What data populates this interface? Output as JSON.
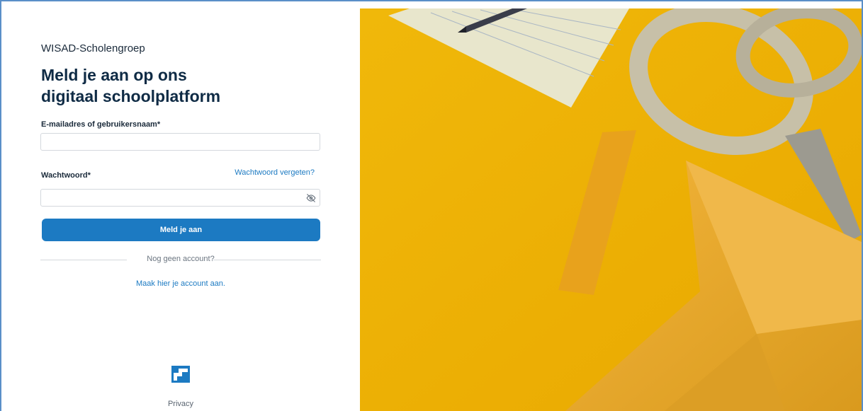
{
  "org_name": "WISAD-Scholengroep",
  "heading_line1": "Meld je aan op ons",
  "heading_line2": "digitaal schoolplatform",
  "login": {
    "username_label": "E-mailadres of gebruikersnaam*",
    "username_value": "",
    "password_label": "Wachtwoord*",
    "password_value": "",
    "forgot_link": "Wachtwoord vergeten?",
    "submit_label": "Meld je aan"
  },
  "divider_text": "Nog geen account?",
  "create_account_link": "Maak hier je account aan.",
  "footer": {
    "privacy_link": "Privacy"
  },
  "icons": {
    "password_toggle": "eye-off-icon",
    "logo": "school-logo-icon"
  },
  "colors": {
    "accent": "#1c7ac2",
    "heading": "#0f2b45",
    "photo_background": "#f2bc0e"
  }
}
